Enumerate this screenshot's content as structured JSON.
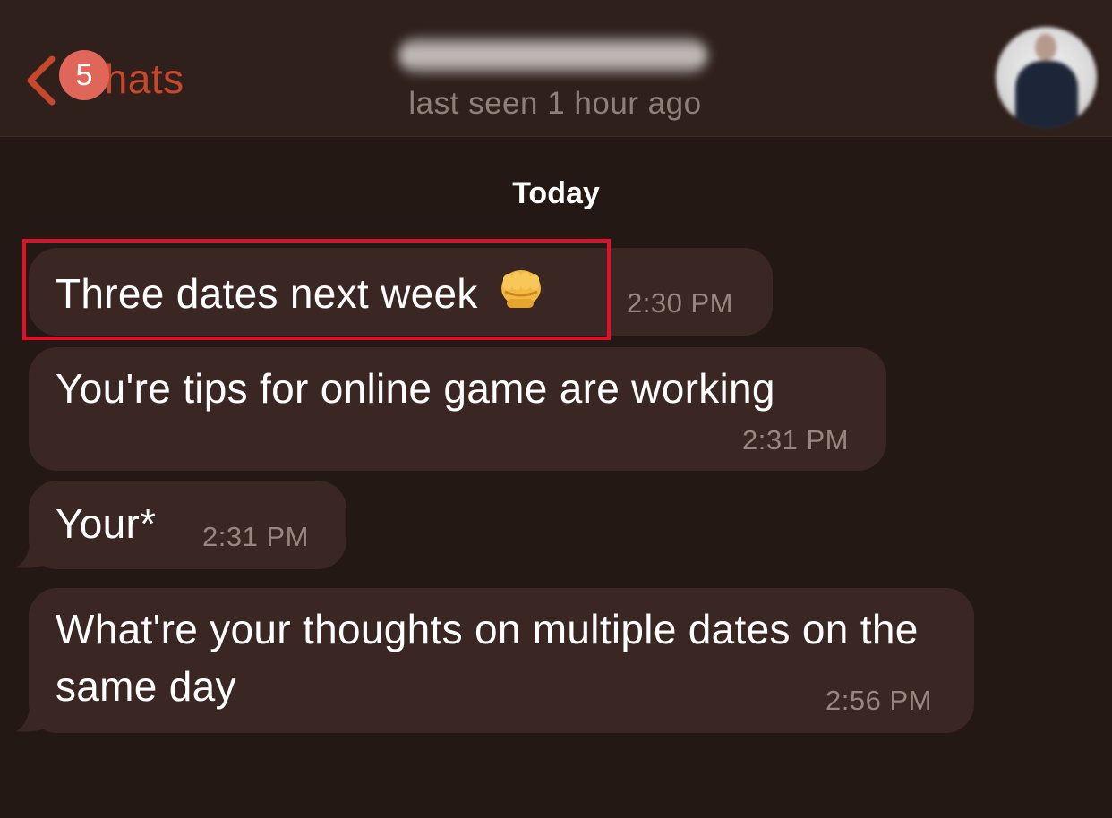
{
  "header": {
    "back_label": "Chats",
    "unread_badge": "5",
    "status": "last seen 1 hour ago"
  },
  "date_separator": "Today",
  "messages": [
    {
      "text": "Three dates next week",
      "emoji": "oncoming-fist",
      "time": "2:30 PM"
    },
    {
      "text": "You're tips for online game are working",
      "time": "2:31 PM"
    },
    {
      "text": "Your*",
      "time": "2:31 PM"
    },
    {
      "text": "What're your thoughts on multiple dates on the same day",
      "time": "2:56 PM"
    }
  ],
  "colors": {
    "accent": "#c8482e",
    "badge": "#e0665a",
    "highlight": "#e0102b",
    "bubble": "#3a2622",
    "background": "#241815"
  }
}
